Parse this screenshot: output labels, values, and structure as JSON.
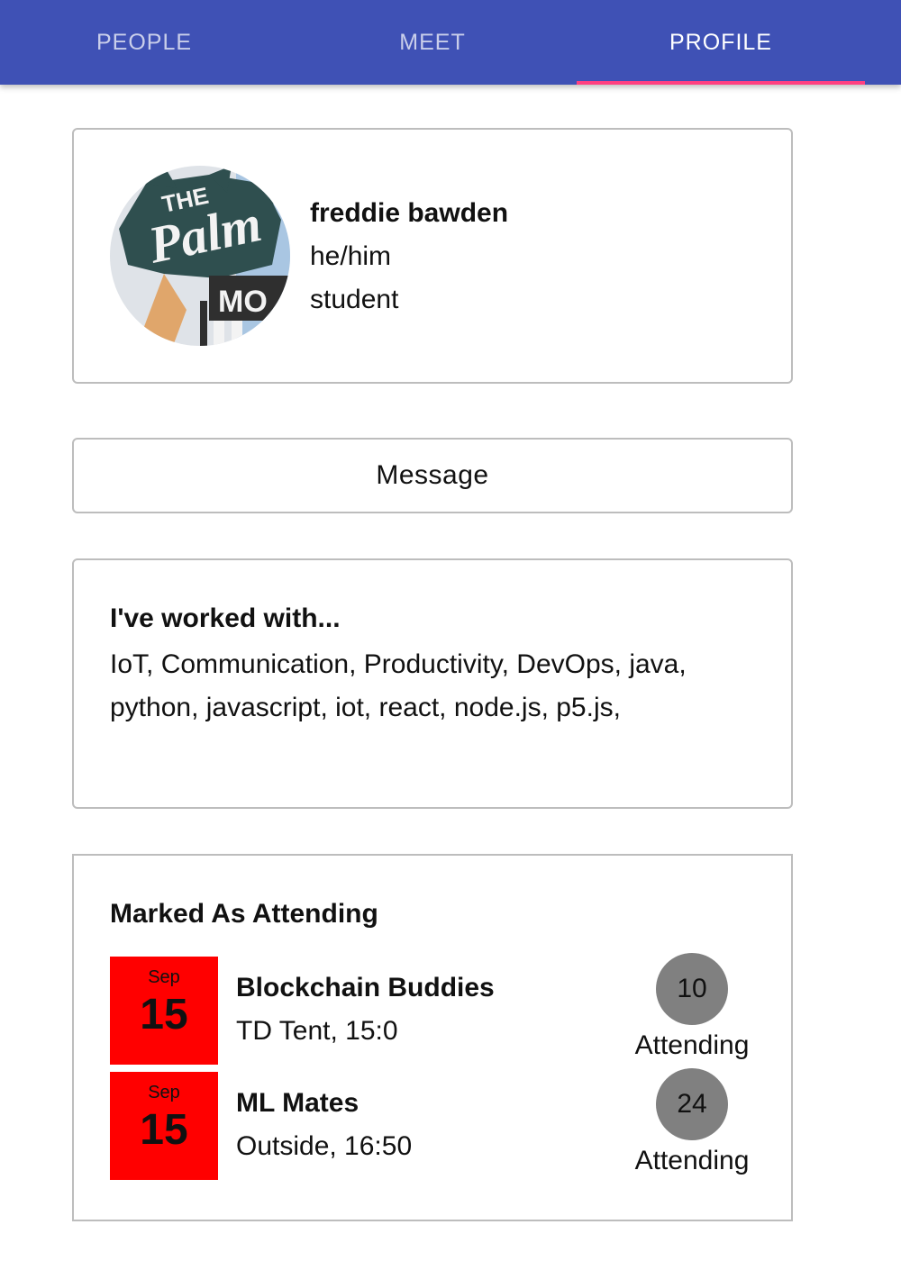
{
  "tabs": [
    {
      "label": "PEOPLE",
      "active": false
    },
    {
      "label": "MEET",
      "active": false
    },
    {
      "label": "PROFILE",
      "active": true
    }
  ],
  "colors": {
    "tab_bar": "#3f51b5",
    "tab_indicator": "#ff4081",
    "date_box": "#ff0000",
    "attending_badge": "#808080"
  },
  "profile": {
    "avatar_icon": "profile-photo",
    "name": "freddie bawden",
    "pronouns": "he/him",
    "role": "student"
  },
  "message_button": {
    "label": "Message"
  },
  "skills": {
    "title": "I've worked with...",
    "text": "IoT, Communication, Productivity, DevOps, java, python, javascript, iot, react, node.js, p5.js,"
  },
  "events": {
    "title": "Marked As Attending",
    "items": [
      {
        "month": "Sep",
        "day": "15",
        "name": "Blockchain Buddies",
        "meta": "TD Tent, 15:0",
        "count": "10",
        "count_label": "Attending"
      },
      {
        "month": "Sep",
        "day": "15",
        "name": "ML Mates",
        "meta": "Outside, 16:50",
        "count": "24",
        "count_label": "Attending"
      }
    ]
  }
}
